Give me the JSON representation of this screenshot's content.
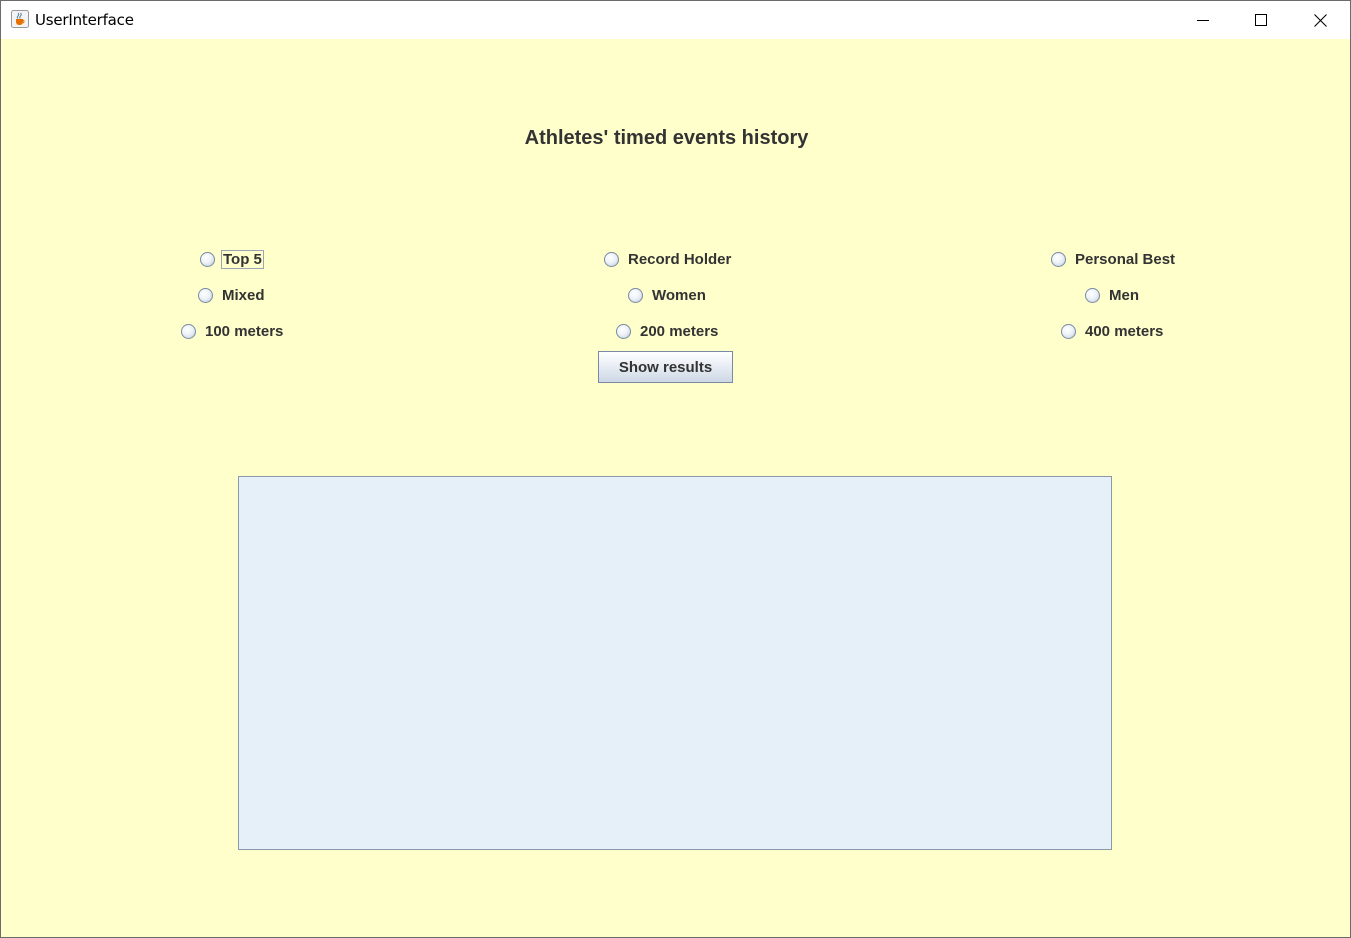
{
  "window": {
    "title": "UserInterface"
  },
  "titlebar_icons": {
    "app": "java-cup-icon",
    "minimize": "minimize-icon",
    "maximize": "maximize-icon",
    "close": "close-icon"
  },
  "heading": "Athletes' timed events history",
  "options": {
    "row1": {
      "left": "Top 5",
      "center": "Record Holder",
      "right": "Personal Best"
    },
    "row2": {
      "left": "Mixed",
      "center": "Women",
      "right": "Men"
    },
    "row3": {
      "left": "100 meters",
      "center": "200 meters",
      "right": "400 meters"
    }
  },
  "show_button": "Show results",
  "results_text": "",
  "colors": {
    "background": "#ffffcc",
    "text": "#333333",
    "results_area": "#e6f0f8"
  }
}
